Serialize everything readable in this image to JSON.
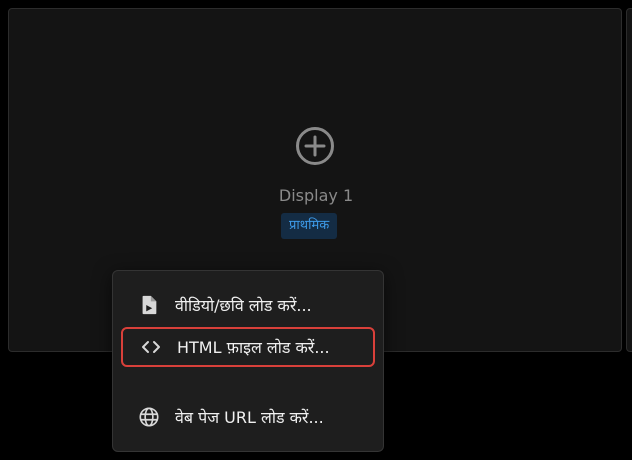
{
  "display": {
    "name": "Display 1",
    "badge": "प्राथमिक"
  },
  "menu": {
    "items": [
      {
        "label": "वीडियो/छवि लोड करें...",
        "icon": "file-video-icon"
      },
      {
        "label": "HTML फ़ाइल लोड करें...",
        "icon": "code-icon"
      },
      {
        "label": "वेब पेज URL लोड करें...",
        "icon": "globe-icon"
      }
    ]
  },
  "colors": {
    "background": "#000000",
    "panel": "#141414",
    "menu": "#1e1e1e",
    "badge_bg": "#142c44",
    "badge_text": "#3d9ae8",
    "highlight": "#d9403a"
  }
}
